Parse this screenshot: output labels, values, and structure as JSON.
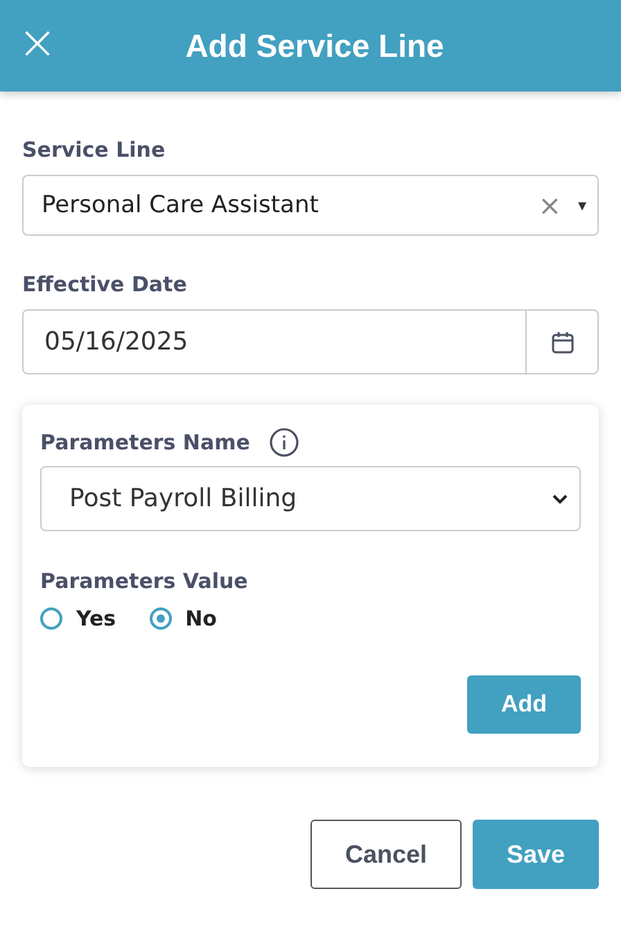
{
  "header": {
    "close": "×",
    "title": "Add Service Line"
  },
  "service_line": {
    "label": "Service Line",
    "value": "Personal Care Assistant",
    "clear": "×",
    "caret": "▾"
  },
  "effective_date": {
    "label": "Effective Date",
    "value": "05/16/2025"
  },
  "parameters": {
    "name_label": "Parameters Name",
    "name_value": "Post Payroll Billing",
    "value_label": "Parameters Value",
    "options": [
      {
        "label": "Yes",
        "selected": false
      },
      {
        "label": "No",
        "selected": true
      }
    ],
    "add_button": "Add"
  },
  "buttons": [
    {
      "label": "Cancel",
      "kind": "secondary"
    },
    {
      "label": "Save",
      "kind": "primary"
    }
  ]
}
